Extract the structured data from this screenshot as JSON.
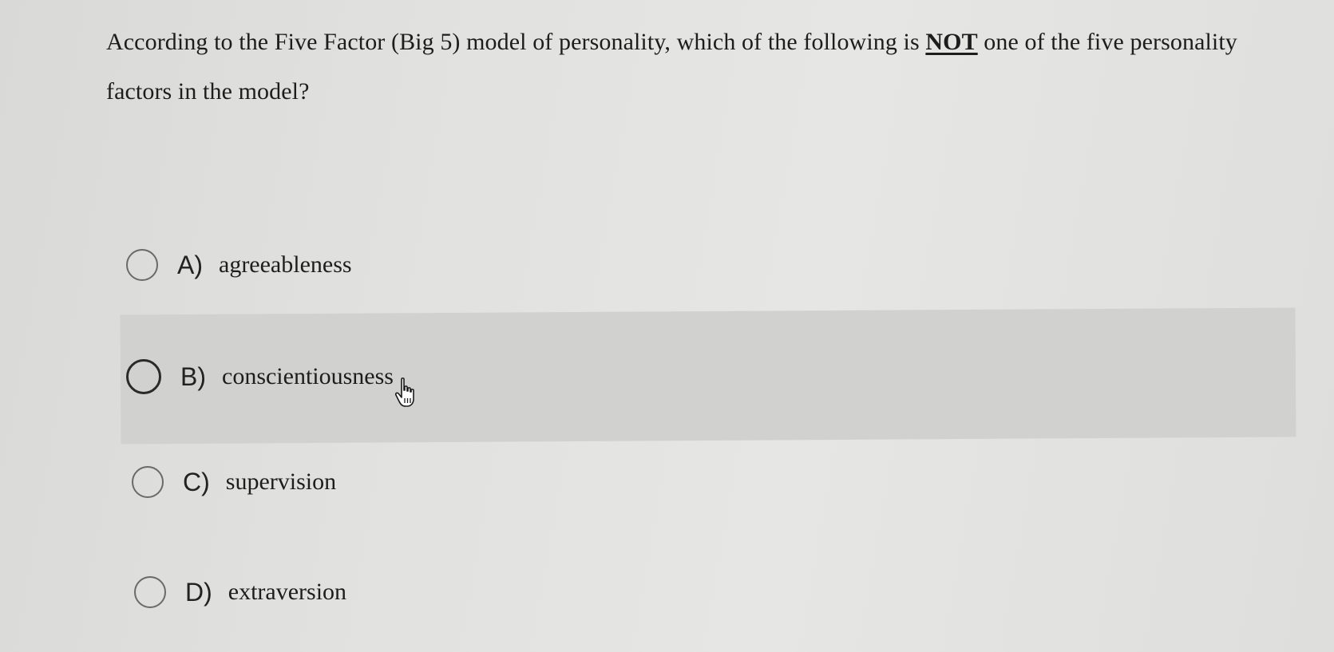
{
  "question": {
    "text_before": "According to the Five Factor (Big 5) model of personality, which of the following is ",
    "emphasis": "NOT",
    "text_after": " one of the five personality factors in the model?"
  },
  "options": [
    {
      "letter": "A)",
      "label": "agreeableness"
    },
    {
      "letter": "B)",
      "label": "conscientiousness"
    },
    {
      "letter": "C)",
      "label": "supervision"
    },
    {
      "letter": "D)",
      "label": "extraversion"
    }
  ],
  "highlighted_option": "B)",
  "cursor_icon": "hand-pointer-icon",
  "colors": {
    "background": "#e1e1df",
    "highlight": "#d1d1cf",
    "text": "#1d1d1d"
  }
}
